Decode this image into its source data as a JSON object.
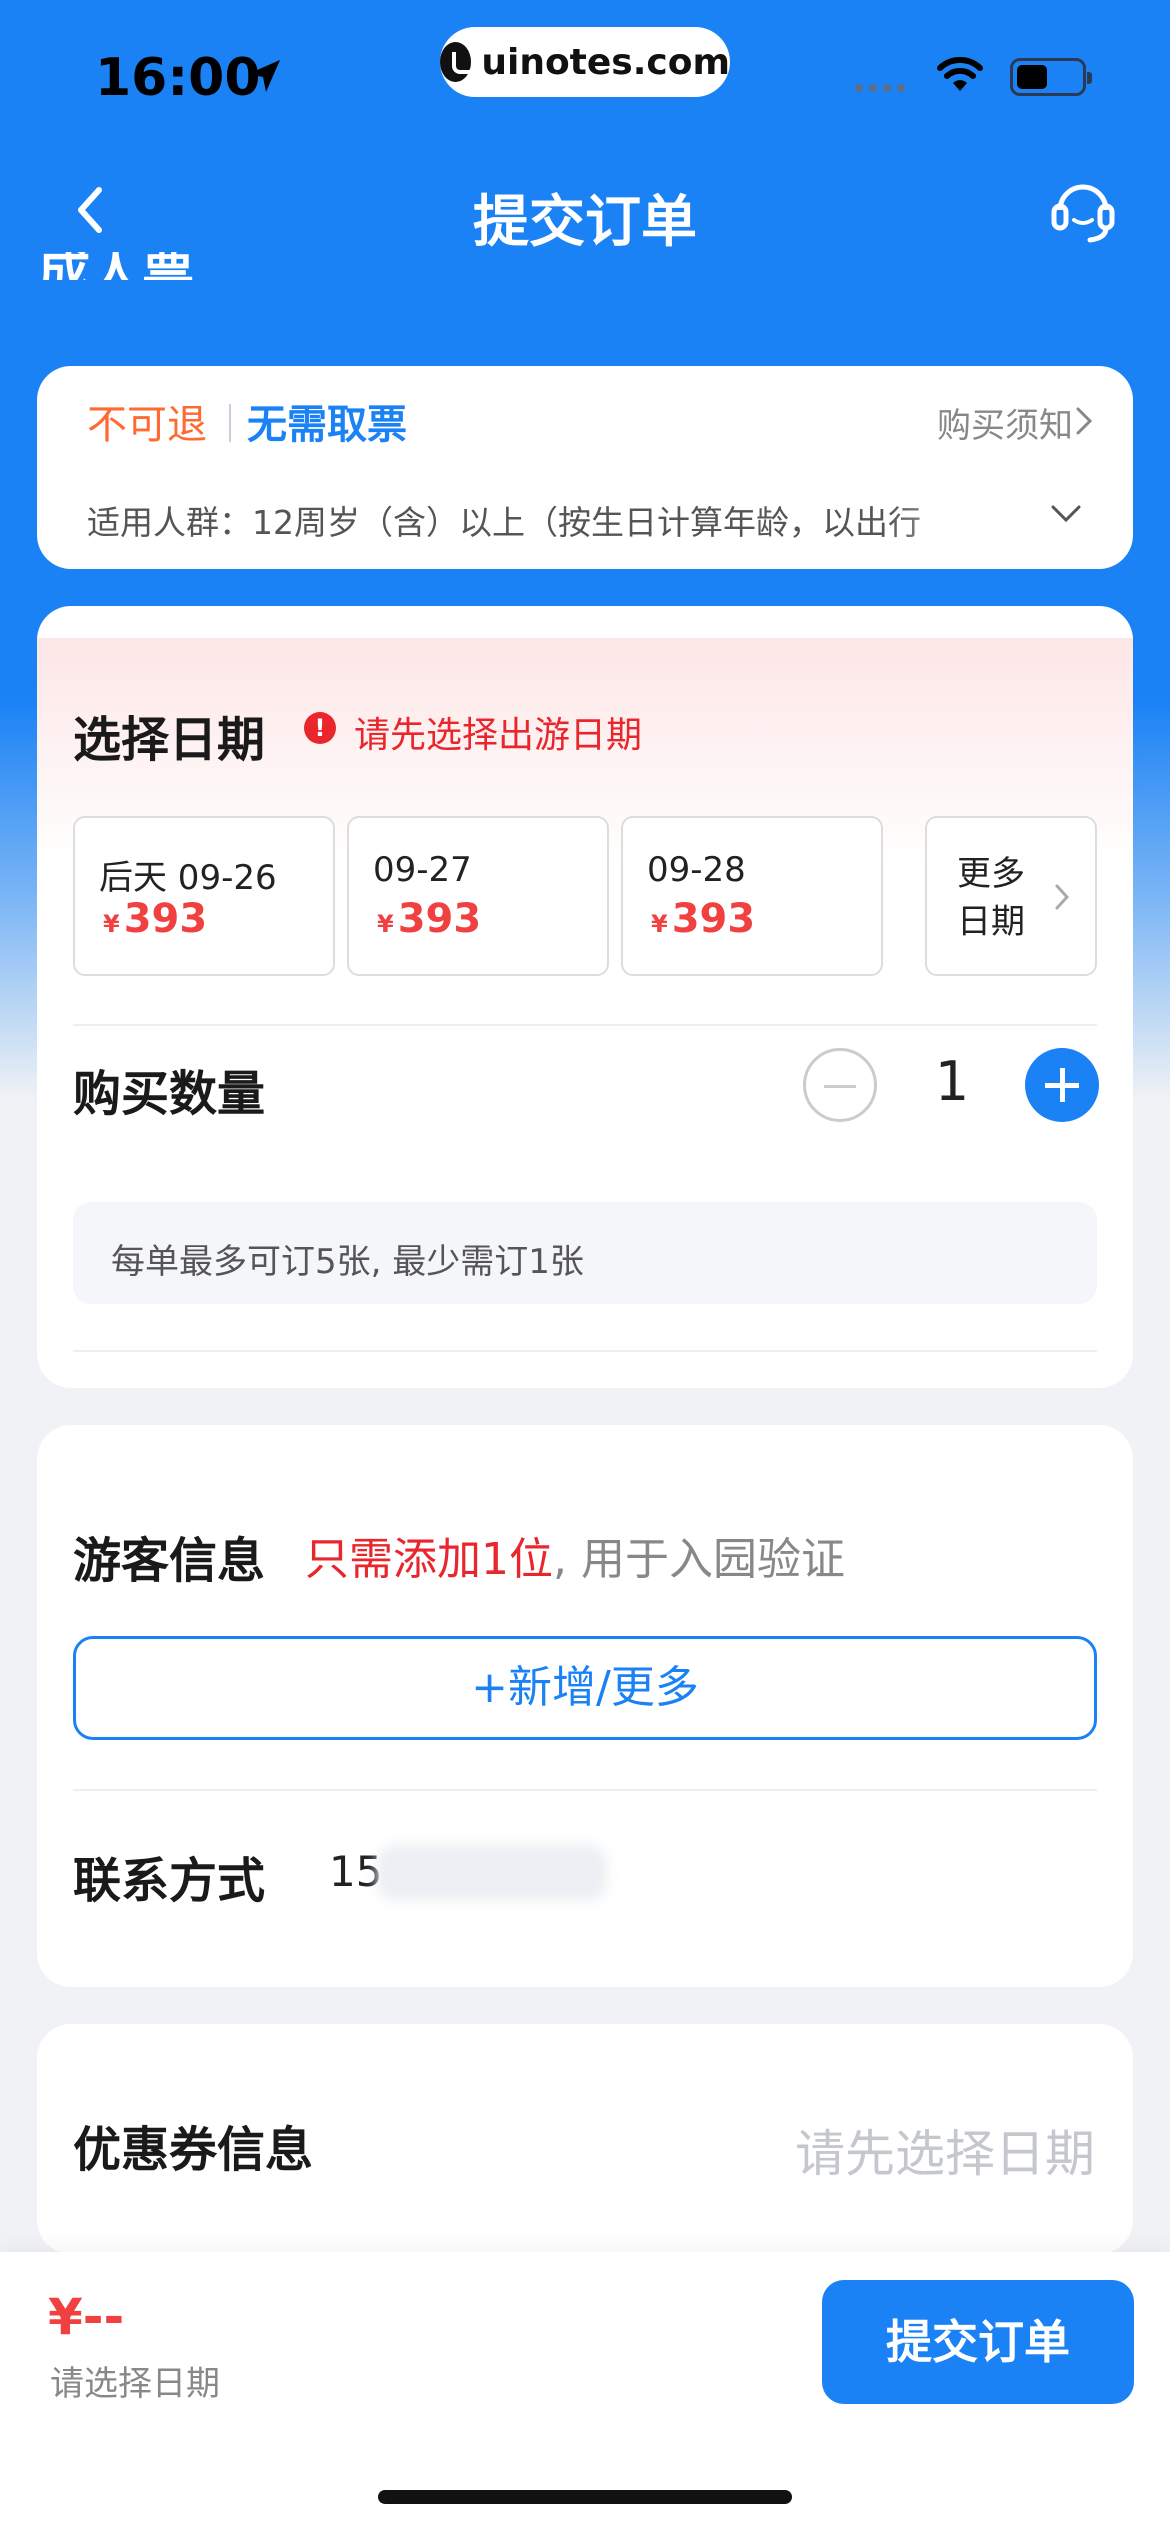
{
  "status_bar": {
    "time": "16:00",
    "url": "uinotes.com"
  },
  "nav": {
    "title": "提交订单",
    "ghost_title": "成人票"
  },
  "ticket_info": {
    "tag_refund": "不可退",
    "tag_pickup": "无需取票",
    "notice_link": "购买须知",
    "audience": "适用人群：12周岁（含）以上（按生日计算年龄，以出行"
  },
  "date_section": {
    "title": "选择日期",
    "warning": "请先选择出游日期",
    "dates": [
      {
        "label": "后天 09-26",
        "currency": "¥",
        "price": "393"
      },
      {
        "label": "09-27",
        "currency": "¥",
        "price": "393"
      },
      {
        "label": "09-28",
        "currency": "¥",
        "price": "393"
      }
    ],
    "more": "更多日期"
  },
  "quantity": {
    "title": "购买数量",
    "value": "1",
    "limit": "每单最多可订5张, 最少需订1张"
  },
  "tourist": {
    "title": "游客信息",
    "highlight": "只需添加1位",
    "hint": ", 用于入园验证",
    "add_button": "+新增/更多",
    "contact_label": "联系方式",
    "contact_value": "15"
  },
  "coupon": {
    "title": "优惠券信息",
    "hint": "请先选择日期"
  },
  "bottom": {
    "price": "¥--",
    "price_hint": "请选择日期",
    "submit": "提交订单"
  },
  "colors": {
    "brand_blue": "#1a82f5",
    "price_red": "#f04040",
    "warn_red": "#e8262c",
    "tag_orange": "#ff6a33"
  }
}
